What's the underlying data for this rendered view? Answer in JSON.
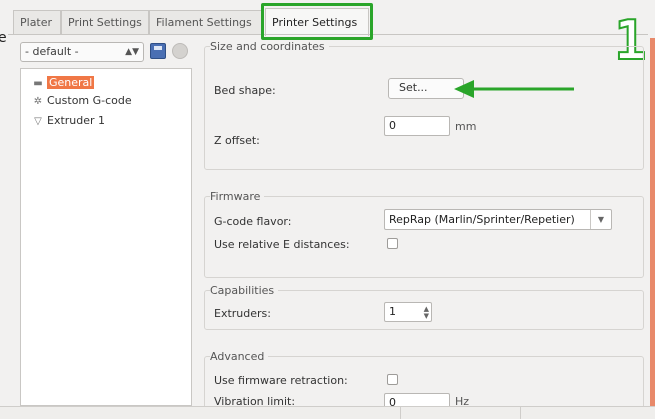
{
  "tabs": [
    {
      "label": "Plater"
    },
    {
      "label": "Print Settings"
    },
    {
      "label": "Filament Settings"
    },
    {
      "label": "Printer Settings"
    }
  ],
  "left_letter": "e",
  "annotation_number": "1",
  "preset": {
    "value": "- default -"
  },
  "tree": [
    {
      "label": "General"
    },
    {
      "label": "Custom G-code"
    },
    {
      "label": "Extruder 1"
    }
  ],
  "sections": {
    "size": {
      "title": "Size and coordinates",
      "bed_shape_label": "Bed shape:",
      "set_button": "Set...",
      "z_offset_label": "Z offset:",
      "z_offset_value": "0",
      "z_offset_unit": "mm"
    },
    "firmware": {
      "title": "Firmware",
      "gcode_flavor_label": "G-code flavor:",
      "gcode_flavor_value": "RepRap (Marlin/Sprinter/Repetier)",
      "relative_e_label": "Use relative E distances:"
    },
    "capabilities": {
      "title": "Capabilities",
      "extruders_label": "Extruders:",
      "extruders_value": "1"
    },
    "advanced": {
      "title": "Advanced",
      "fw_retraction_label": "Use firmware retraction:",
      "vibration_label": "Vibration limit:",
      "vibration_value": "0",
      "vibration_unit": "Hz"
    }
  },
  "colors": {
    "accent_green": "#2aa52a",
    "selection_orange": "#f07746"
  }
}
